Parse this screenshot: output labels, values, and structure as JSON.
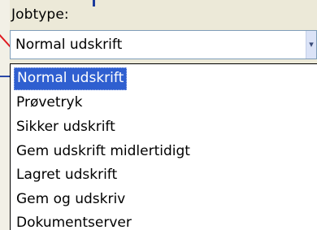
{
  "field": {
    "label": "Jobtype:",
    "value": "Normal udskrift",
    "arrow_icon": "chevron-down-icon"
  },
  "dropdown": {
    "options": [
      "Normal udskrift",
      "Prøvetryk",
      "Sikker udskrift",
      "Gem udskrift midlertidigt",
      "Lagret udskrift",
      "Gem og udskriv",
      "Dokumentserver"
    ],
    "selected_index": 0
  },
  "colors": {
    "highlight": "#2f5fd0",
    "window_bg": "#ece9d8",
    "border": "#7f9db9"
  }
}
